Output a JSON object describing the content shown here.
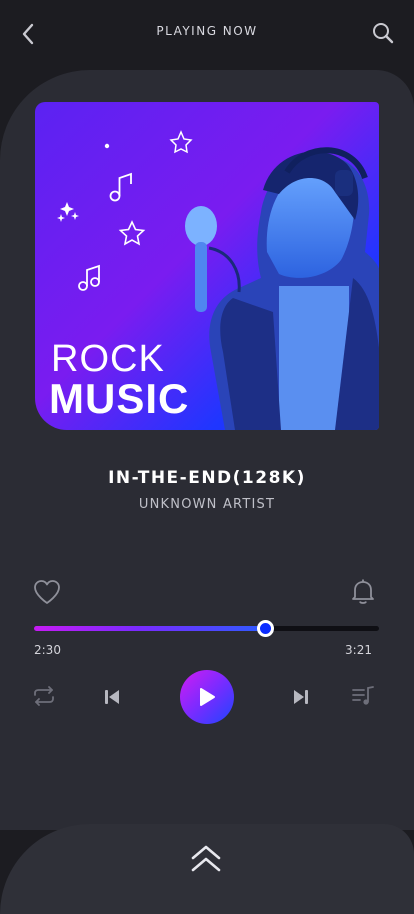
{
  "header": {
    "title": "PLAYING NOW"
  },
  "album": {
    "line1": "ROCK",
    "line2": "MUSIC"
  },
  "track": {
    "title": "IN-THE-END(128K)",
    "artist": "UNKNOWN ARTIST"
  },
  "player": {
    "current_time": "2:30",
    "total_time": "3:21",
    "progress": 0.67
  },
  "icons": {
    "back": "chevron-left-icon",
    "search": "search-icon",
    "like": "heart-icon",
    "notify": "bell-icon",
    "repeat": "repeat-icon",
    "previous": "skip-back-icon",
    "play": "play-icon",
    "next": "skip-forward-icon",
    "playlist": "playlist-icon",
    "expand": "chevron-up-double-icon"
  },
  "colors": {
    "accent_start": "#d21cf2",
    "accent_end": "#1e45ff",
    "background": "#1c1c21",
    "card": "#2b2c34"
  }
}
